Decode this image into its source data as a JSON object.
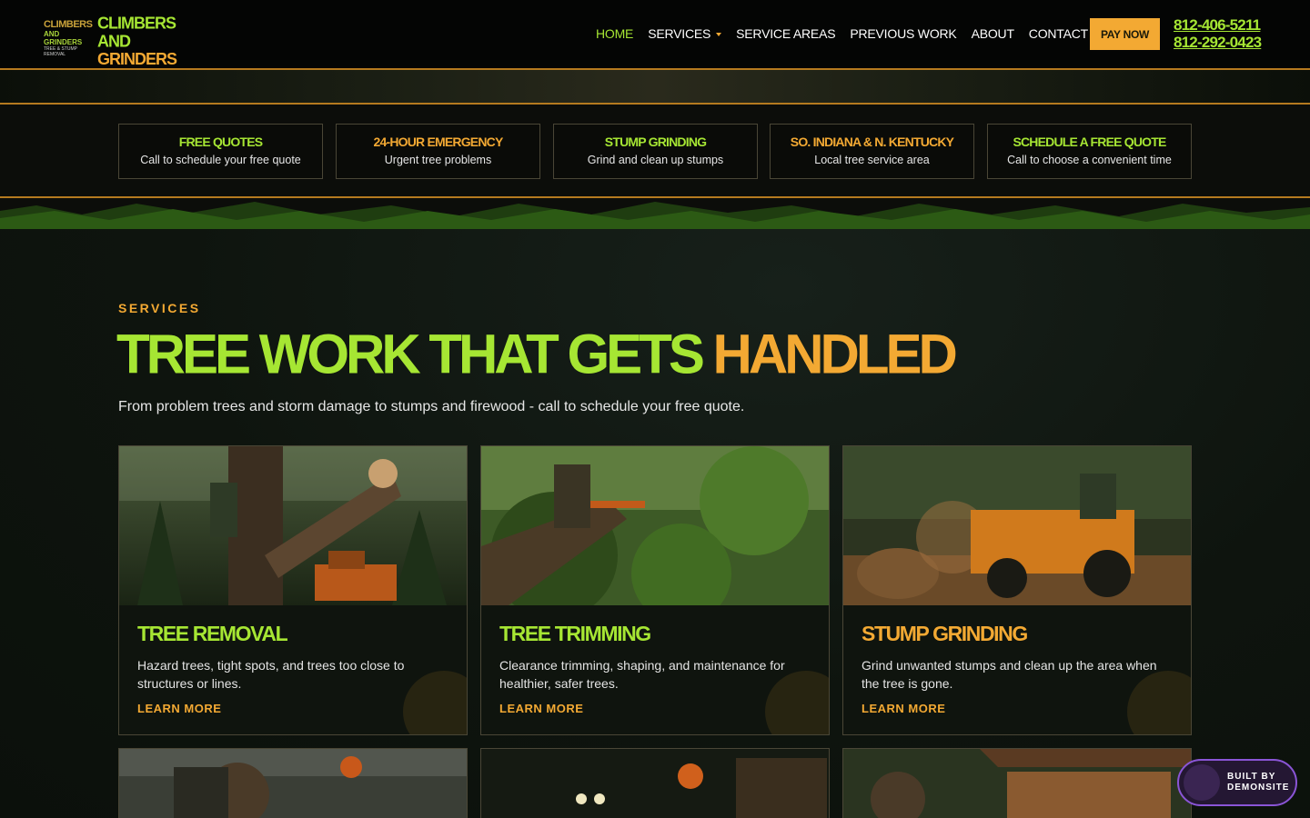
{
  "header": {
    "logo": {
      "line1": "CLIMBERS",
      "line2": "AND GRINDERS",
      "line3": "TREE & STUMP REMOVAL"
    },
    "brand": {
      "line1": "CLIMBERS AND",
      "line2": "GRINDERS"
    },
    "nav": [
      {
        "label": "HOME"
      },
      {
        "label": "SERVICES"
      },
      {
        "label": "SERVICE AREAS"
      },
      {
        "label": "PREVIOUS WORK"
      },
      {
        "label": "ABOUT"
      },
      {
        "label": "CONTACT"
      }
    ],
    "pay_label": "PAY NOW",
    "phones": [
      "812-406-5211",
      "812-292-0423"
    ]
  },
  "features": [
    {
      "title": "FREE QUOTES",
      "desc": "Call to schedule your free quote",
      "color": "#a6e633"
    },
    {
      "title": "24-HOUR EMERGENCY",
      "desc": "Urgent tree problems",
      "color": "#f3a933"
    },
    {
      "title": "STUMP GRINDING",
      "desc": "Grind and clean up stumps",
      "color": "#a6e633"
    },
    {
      "title": "SO. INDIANA & N. KENTUCKY",
      "desc": "Local tree service area",
      "color": "#f3a933"
    },
    {
      "title": "SCHEDULE A FREE QUOTE",
      "desc": "Call to choose a convenient time",
      "color": "#a6e633"
    }
  ],
  "services": {
    "eyebrow": "SERVICES",
    "headline_part1": "TREE WORK THAT GETS ",
    "headline_part2": "HANDLED",
    "subline": "From problem trees and storm damage to stumps and firewood - call to schedule your free quote.",
    "cards": [
      {
        "title": "TREE REMOVAL",
        "desc": "Hazard trees, tight spots, and trees too close to structures or lines.",
        "link": "LEARN MORE",
        "title_color": "#a6e633"
      },
      {
        "title": "TREE TRIMMING",
        "desc": "Clearance trimming, shaping, and maintenance for healthier, safer trees.",
        "link": "LEARN MORE",
        "title_color": "#a6e633"
      },
      {
        "title": "STUMP GRINDING",
        "desc": "Grind unwanted stumps and clean up the area when the tree is gone.",
        "link": "LEARN MORE",
        "title_color": "#f3a933"
      }
    ]
  },
  "badge": {
    "line1": "BUILT BY",
    "line2": "DEMONSITE"
  },
  "colors": {
    "green": "#a6e633",
    "orange": "#f3a933",
    "border": "#b57a1f"
  }
}
